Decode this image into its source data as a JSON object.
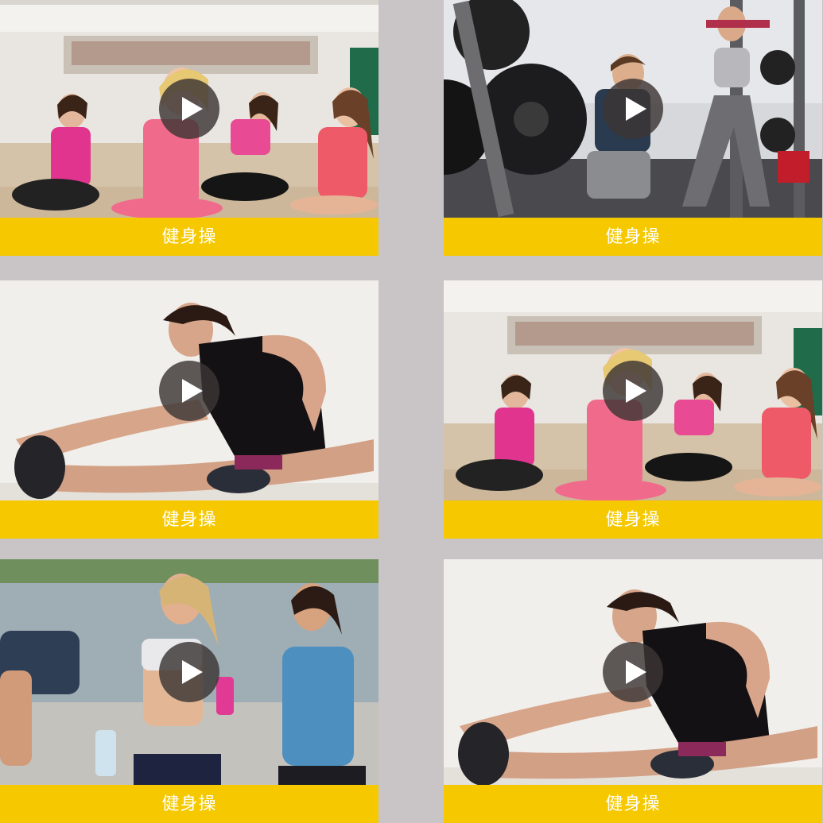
{
  "colors": {
    "page_background": "#c9c5c6",
    "label_bar": "#f5c800",
    "label_text": "#ffffff",
    "play_button": "#3c3634"
  },
  "grid": {
    "cards": [
      {
        "label": "健身操",
        "scene": "group of women stretching on mats in a gym studio",
        "icon": "play-icon"
      },
      {
        "label": "健身操",
        "scene": "man and woman doing lunges in a weight room",
        "icon": "play-icon"
      },
      {
        "label": "健身操",
        "scene": "woman in black top stretching to touch her shoe",
        "icon": "play-icon"
      },
      {
        "label": "健身操",
        "scene": "group of women stretching on mats in a gym studio",
        "icon": "play-icon"
      },
      {
        "label": "健身操",
        "scene": "women jogging outdoors with water bottle",
        "icon": "play-icon"
      },
      {
        "label": "健身操",
        "scene": "woman in black top stretching to touch her shoe",
        "icon": "play-icon"
      }
    ]
  }
}
